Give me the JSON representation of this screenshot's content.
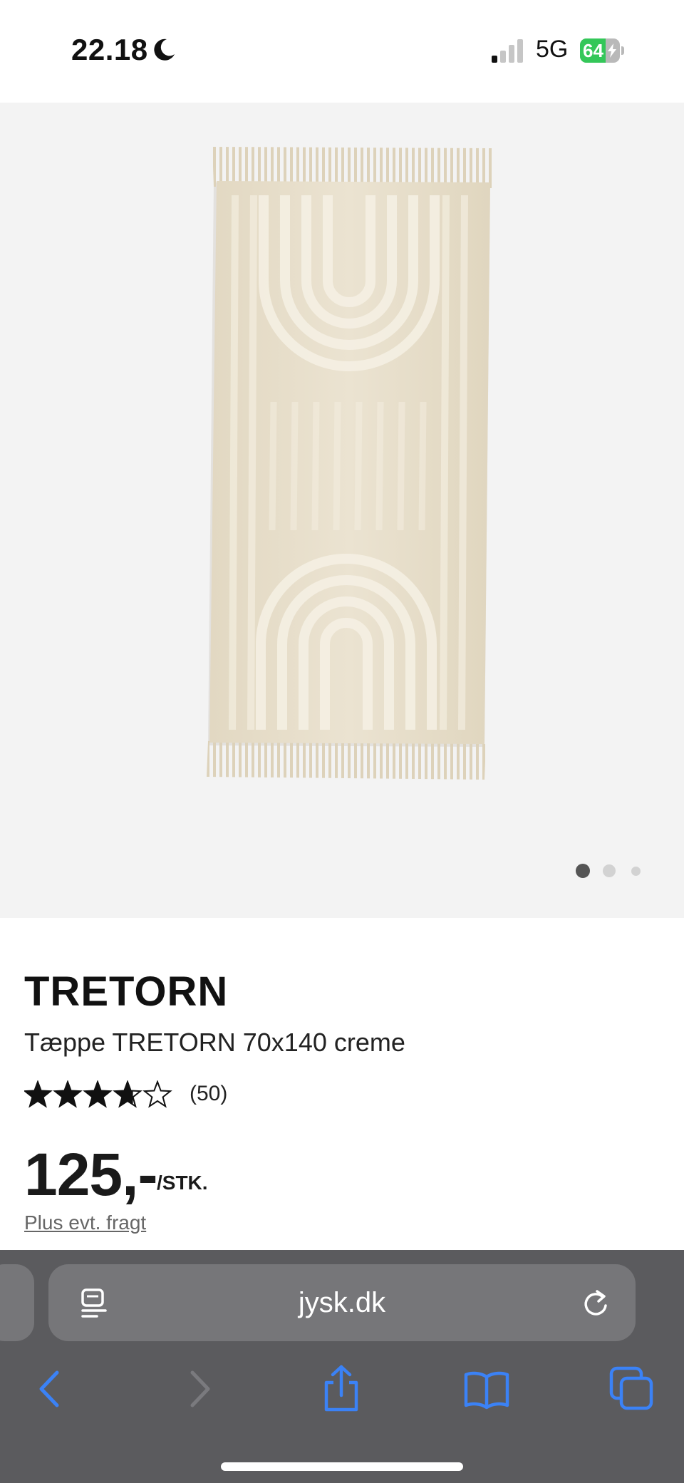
{
  "status_bar": {
    "time": "22.18",
    "network": "5G",
    "battery": "64",
    "battery_level": 0.64,
    "icons": [
      "moon-icon",
      "signal-icon",
      "battery-icon"
    ]
  },
  "gallery": {
    "image": "rug-product-image",
    "slide_count": 3,
    "active_slide": 1
  },
  "product": {
    "brand": "TRETORN",
    "name": "Tæppe TRETORN 70x140 creme",
    "rating": 3.7,
    "rating_max": 5,
    "review_count": "(50)",
    "price": "125,-",
    "price_unit": "/STK.",
    "shipping_note": "Plus evt. fragt"
  },
  "browser": {
    "url": "jysk.dk",
    "accent_color": "#3b82f6",
    "toolbar": [
      "back-icon",
      "forward-icon",
      "share-icon",
      "bookmarks-icon",
      "tabs-icon"
    ]
  }
}
